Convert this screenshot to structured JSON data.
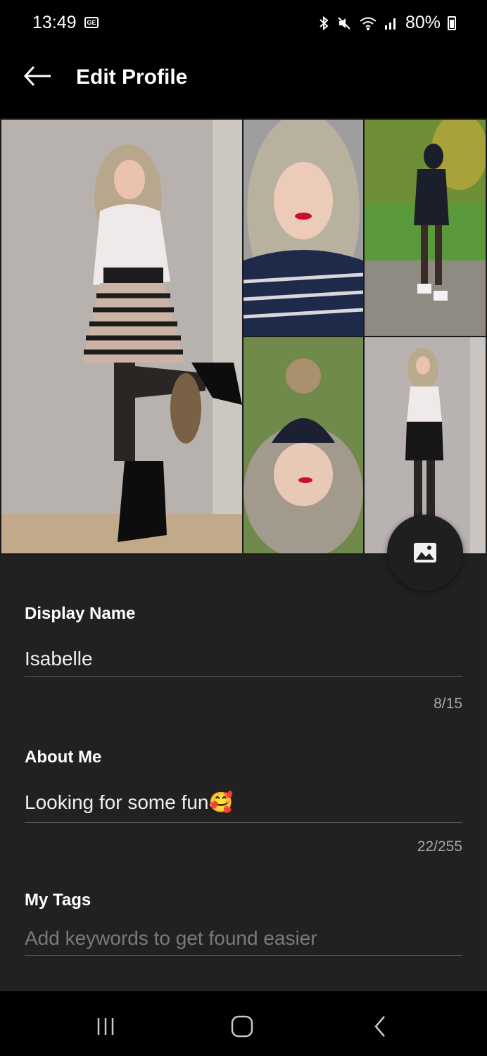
{
  "status_bar": {
    "time": "13:49",
    "ge_badge": "GE",
    "battery": "80%",
    "icons": [
      "bluetooth-icon",
      "mute-icon",
      "wifi-icon",
      "signal-icon",
      "battery-icon"
    ]
  },
  "header": {
    "title": "Edit Profile",
    "back_icon": "arrow-left-icon"
  },
  "photos": {
    "count": 5,
    "add_icon": "image-icon"
  },
  "display_name": {
    "label": "Display Name",
    "value": "Isabelle",
    "counter": "8/15"
  },
  "about_me": {
    "label": "About Me",
    "value": "Looking for some fun",
    "emoji": "🥰",
    "counter": "22/255"
  },
  "my_tags": {
    "label": "My Tags",
    "placeholder": "Add keywords to get found easier"
  },
  "nav": {
    "icons": [
      "recent-apps-icon",
      "home-icon",
      "back-icon"
    ]
  },
  "colors": {
    "background": "#000000",
    "panel": "#212121",
    "text": "#ffffff",
    "muted": "#7a7a7a",
    "divider": "#5e5e5e"
  }
}
